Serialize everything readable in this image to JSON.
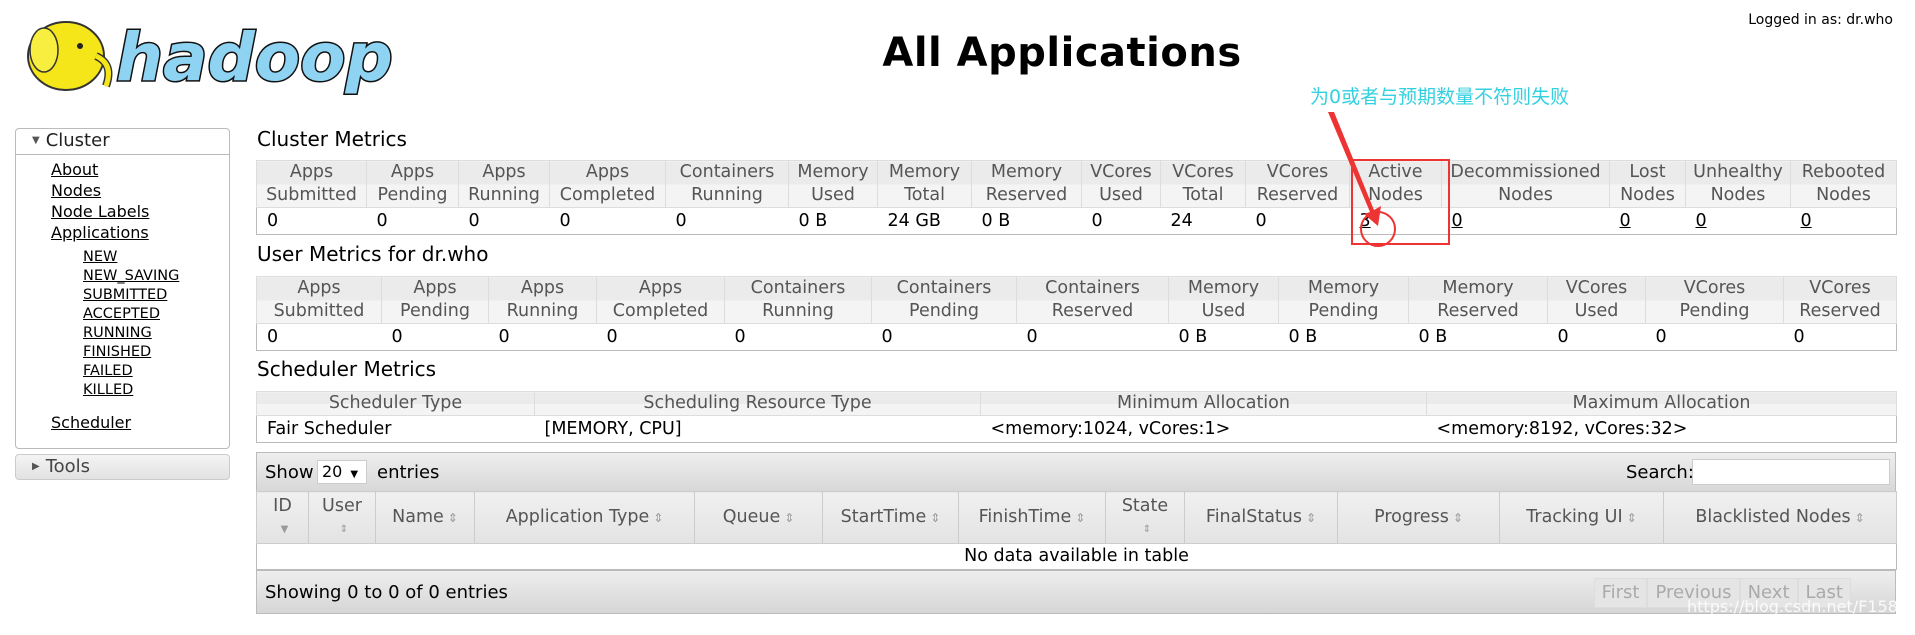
{
  "header": {
    "logo_text": "hadoop",
    "title": "All Applications",
    "logged_in": "Logged in as: dr.who"
  },
  "sidebar": {
    "cluster_label": "Cluster",
    "items": [
      "About",
      "Nodes",
      "Node Labels",
      "Applications"
    ],
    "app_states": [
      "NEW",
      "NEW_SAVING",
      "SUBMITTED",
      "ACCEPTED",
      "RUNNING",
      "FINISHED",
      "FAILED",
      "KILLED"
    ],
    "scheduler": "Scheduler",
    "tools_label": "Tools"
  },
  "cluster_metrics": {
    "title": "Cluster Metrics",
    "headers": [
      [
        "Apps",
        "Submitted"
      ],
      [
        "Apps",
        "Pending"
      ],
      [
        "Apps",
        "Running"
      ],
      [
        "Apps",
        "Completed"
      ],
      [
        "Containers",
        "Running"
      ],
      [
        "Memory",
        "Used"
      ],
      [
        "Memory",
        "Total"
      ],
      [
        "Memory",
        "Reserved"
      ],
      [
        "VCores",
        "Used"
      ],
      [
        "VCores",
        "Total"
      ],
      [
        "VCores",
        "Reserved"
      ],
      [
        "Active",
        "Nodes"
      ],
      [
        "Decommissioned",
        "Nodes"
      ],
      [
        "Lost",
        "Nodes"
      ],
      [
        "Unhealthy",
        "Nodes"
      ],
      [
        "Rebooted",
        "Nodes"
      ]
    ],
    "values": [
      "0",
      "0",
      "0",
      "0",
      "0",
      "0 B",
      "24 GB",
      "0 B",
      "0",
      "24",
      "0",
      "3",
      "0",
      "0",
      "0",
      "0"
    ]
  },
  "user_metrics": {
    "title": "User Metrics for dr.who",
    "headers": [
      [
        "Apps",
        "Submitted"
      ],
      [
        "Apps",
        "Pending"
      ],
      [
        "Apps",
        "Running"
      ],
      [
        "Apps",
        "Completed"
      ],
      [
        "Containers",
        "Running"
      ],
      [
        "Containers",
        "Pending"
      ],
      [
        "Containers",
        "Reserved"
      ],
      [
        "Memory",
        "Used"
      ],
      [
        "Memory",
        "Pending"
      ],
      [
        "Memory",
        "Reserved"
      ],
      [
        "VCores",
        "Used"
      ],
      [
        "VCores",
        "Pending"
      ],
      [
        "VCores",
        "Reserved"
      ]
    ],
    "values": [
      "0",
      "0",
      "0",
      "0",
      "0",
      "0",
      "0",
      "0 B",
      "0 B",
      "0 B",
      "0",
      "0",
      "0"
    ]
  },
  "scheduler_metrics": {
    "title": "Scheduler Metrics",
    "headers": [
      "Scheduler Type",
      "Scheduling Resource Type",
      "Minimum Allocation",
      "Maximum Allocation"
    ],
    "values": [
      "Fair Scheduler",
      "[MEMORY, CPU]",
      "<memory:1024, vCores:1>",
      "<memory:8192, vCores:32>"
    ]
  },
  "apps_table": {
    "show_label": "Show",
    "entries_value": "20",
    "entries_label": "entries",
    "search_label": "Search:",
    "search_value": "",
    "headers": [
      "ID",
      "User",
      "Name",
      "Application Type",
      "Queue",
      "StartTime",
      "FinishTime",
      "State",
      "FinalStatus",
      "Progress",
      "Tracking UI",
      "Blacklisted Nodes"
    ],
    "empty": "No data available in table",
    "info": "Showing 0 to 0 of 0 entries",
    "pager": [
      "First",
      "Previous",
      "Next",
      "Last"
    ]
  },
  "annotation": {
    "text": "为0或者与预期数量不符则失败",
    "color": "#33d1e0",
    "highlight_color": "#ee3333"
  },
  "watermark": "https://blog.csdn.net/F15844944"
}
